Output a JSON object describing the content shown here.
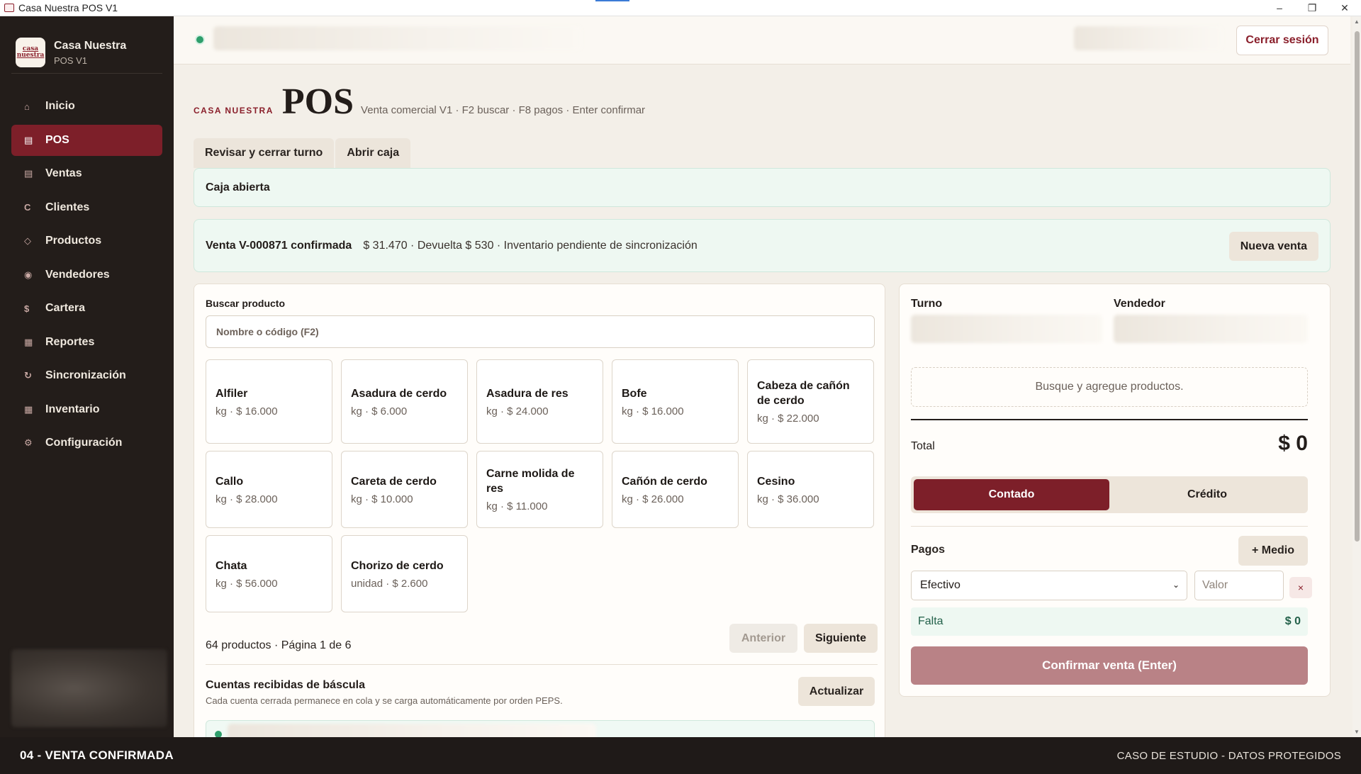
{
  "window": {
    "title": "Casa Nuestra POS V1",
    "minimize": "–",
    "maximize": "❐",
    "close": "✕"
  },
  "sidebar": {
    "brand_name": "Casa Nuestra",
    "brand_sub": "POS V1",
    "logo_top": "casa",
    "logo_bottom": "nuestra",
    "items": [
      {
        "label": "Inicio",
        "icon": "⌂",
        "icon_name": "home-icon"
      },
      {
        "label": "POS",
        "icon": "▤",
        "icon_name": "register-icon",
        "active": true
      },
      {
        "label": "Ventas",
        "icon": "▤",
        "icon_name": "sales-icon"
      },
      {
        "label": "Clientes",
        "icon": "C",
        "icon_name": "clients-icon"
      },
      {
        "label": "Productos",
        "icon": "◇",
        "icon_name": "products-icon"
      },
      {
        "label": "Vendedores",
        "icon": "◉",
        "icon_name": "sellers-icon"
      },
      {
        "label": "Cartera",
        "icon": "$",
        "icon_name": "portfolio-icon"
      },
      {
        "label": "Reportes",
        "icon": "▦",
        "icon_name": "reports-icon"
      },
      {
        "label": "Sincronización",
        "icon": "↻",
        "icon_name": "sync-icon"
      },
      {
        "label": "Inventario",
        "icon": "▦",
        "icon_name": "inventory-icon"
      },
      {
        "label": "Configuración",
        "icon": "⚙",
        "icon_name": "settings-icon"
      }
    ]
  },
  "topbar": {
    "logout_label": "Cerrar sesión"
  },
  "header": {
    "kicker": "CASA NUESTRA",
    "title": "POS",
    "hint": "Venta comercial V1 · F2 buscar · F8 pagos · Enter confirmar"
  },
  "tabs": [
    "Revisar y cerrar turno",
    "Abrir caja"
  ],
  "cash_banner": "Caja abierta",
  "sale_banner": {
    "id": "Venta V-000871 confirmada",
    "detail": "$ 31.470 · Devuelta $ 530 · Inventario pendiente de sincronización",
    "new_sale_label": "Nueva venta"
  },
  "products": {
    "search_label": "Buscar producto",
    "search_placeholder": "Nombre o código (F2)",
    "items": [
      {
        "name": "Alfiler",
        "price": "kg · $ 16.000"
      },
      {
        "name": "Asadura de cerdo",
        "price": "kg · $ 6.000"
      },
      {
        "name": "Asadura de res",
        "price": "kg · $ 24.000"
      },
      {
        "name": "Bofe",
        "price": "kg · $ 16.000"
      },
      {
        "name": "Cabeza de cañón de cerdo",
        "price": "kg · $ 22.000"
      },
      {
        "name": "Callo",
        "price": "kg · $ 28.000"
      },
      {
        "name": "Careta de cerdo",
        "price": "kg · $ 10.000"
      },
      {
        "name": "Carne molida de res",
        "price": "kg · $ 11.000"
      },
      {
        "name": "Cañón de cerdo",
        "price": "kg · $ 26.000"
      },
      {
        "name": "Cesino",
        "price": "kg · $ 36.000"
      },
      {
        "name": "Chata",
        "price": "kg · $ 56.000"
      },
      {
        "name": "Chorizo de cerdo",
        "price": "unidad · $ 2.600"
      }
    ],
    "pager_info": "64 productos · Página 1 de 6",
    "prev_label": "Anterior",
    "next_label": "Siguiente",
    "scale_title": "Cuentas recibidas de báscula",
    "scale_sub": "Cada cuenta cerrada permanece en cola y se carga automáticamente por orden PEPS.",
    "refresh_label": "Actualizar"
  },
  "sale": {
    "shift_label": "Turno",
    "seller_label": "Vendedor",
    "empty_cart": "Busque y agregue productos.",
    "total_label": "Total",
    "total_value": "$ 0",
    "mode_cash": "Contado",
    "mode_credit": "Crédito",
    "payments_label": "Pagos",
    "add_method_label": "+ Medio",
    "method_selected": "Efectivo",
    "value_placeholder": "Valor",
    "remove_label": "×",
    "missing_label": "Falta",
    "missing_value": "$ 0",
    "confirm_label": "Confirmar venta (Enter)"
  },
  "statusbar": {
    "left": "04 - VENTA CONFIRMADA",
    "right": "CASO DE ESTUDIO - DATOS PROTEGIDOS"
  },
  "colors": {
    "brand": "#7d1f29",
    "sidebar_bg": "#231d1a",
    "success_bg": "#eef8f2",
    "online": "#2e9e6b"
  }
}
